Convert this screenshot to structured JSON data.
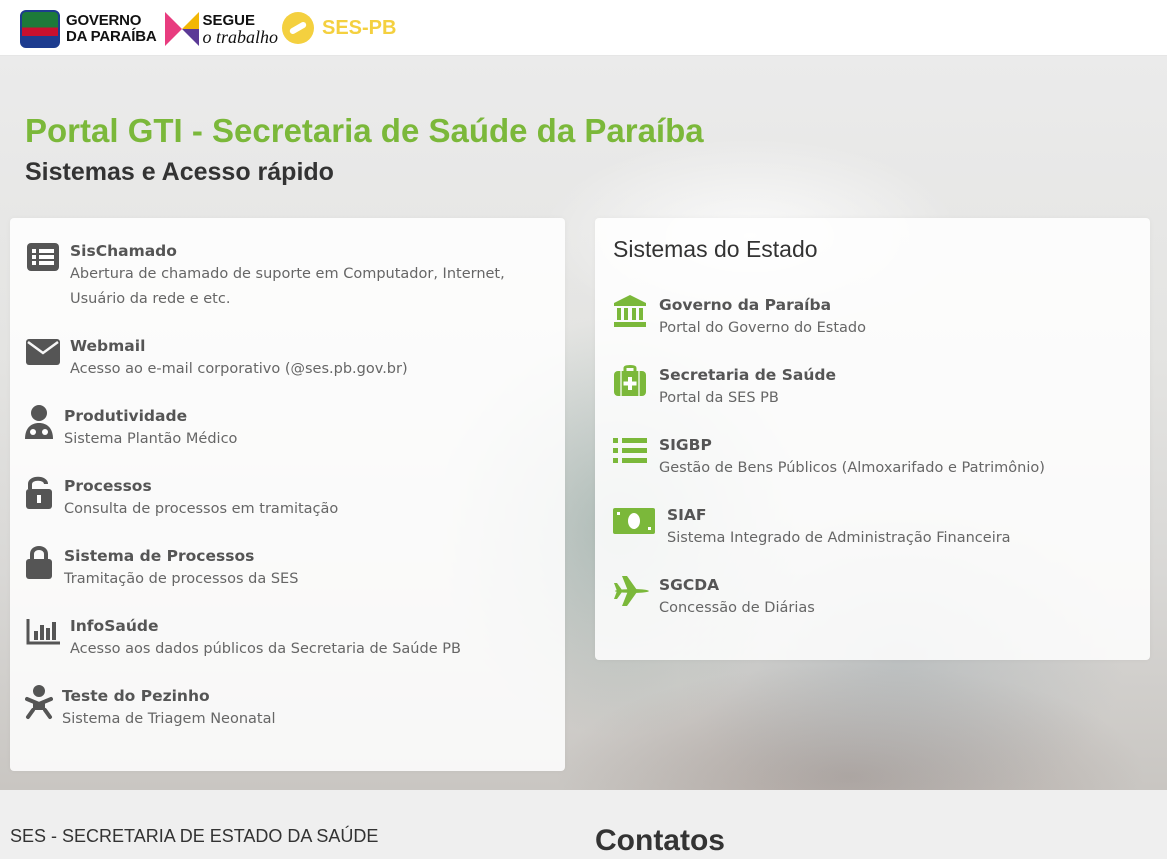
{
  "header": {
    "gov_logo_line1": "GOVERNO",
    "gov_logo_line2": "DA PARAÍBA",
    "slogan_line1": "SEGUE",
    "slogan_line2": "o trabalho",
    "ses_logo": "SES-PB"
  },
  "page": {
    "title": "Portal GTI - Secretaria de Saúde da Paraíba",
    "subtitle": "Sistemas e Acesso rápido"
  },
  "left_systems": [
    {
      "title": "SisChamado",
      "desc": "Abertura de chamado de suporte em Computador, Internet,\nUsuário da rede e etc.",
      "icon": "list-icon"
    },
    {
      "title": "Webmail",
      "desc": "Acesso ao e-mail corporativo (@ses.pb.gov.br)",
      "icon": "envelope-icon"
    },
    {
      "title": "Produtividade",
      "desc": "Sistema Plantão Médico",
      "icon": "doctor-icon"
    },
    {
      "title": "Processos",
      "desc": "Consulta de processos em tramitação",
      "icon": "unlock-icon"
    },
    {
      "title": "Sistema de Processos",
      "desc": "Tramitação de processos da SES",
      "icon": "lock-icon"
    },
    {
      "title": "InfoSaúde",
      "desc": "Acesso aos dados públicos da Secretaria de Saúde PB",
      "icon": "bar-chart-icon"
    },
    {
      "title": "Teste do Pezinho",
      "desc": "Sistema de Triagem Neonatal",
      "icon": "baby-icon"
    }
  ],
  "state_systems": {
    "heading": "Sistemas do Estado",
    "items": [
      {
        "title": "Governo da Paraíba",
        "desc": "Portal do Governo do Estado",
        "icon": "institution-icon"
      },
      {
        "title": "Secretaria de Saúde",
        "desc": "Portal da SES PB",
        "icon": "medkit-icon"
      },
      {
        "title": "SIGBP",
        "desc": "Gestão de Bens Públicos (Almoxarifado e Patrimônio)",
        "icon": "list-ul-icon"
      },
      {
        "title": "SIAF",
        "desc": "Sistema Integrado de Administração Financeira",
        "icon": "money-icon"
      },
      {
        "title": "SGCDA",
        "desc": "Concessão de Diárias",
        "icon": "plane-icon"
      }
    ]
  },
  "footer": {
    "org_name": "SES - SECRETARIA DE ESTADO DA SAÚDE",
    "contacts_heading": "Contatos"
  },
  "colors": {
    "accent_green": "#7bb83a",
    "ses_yellow": "#f4d03f",
    "text_dark": "#333333"
  }
}
